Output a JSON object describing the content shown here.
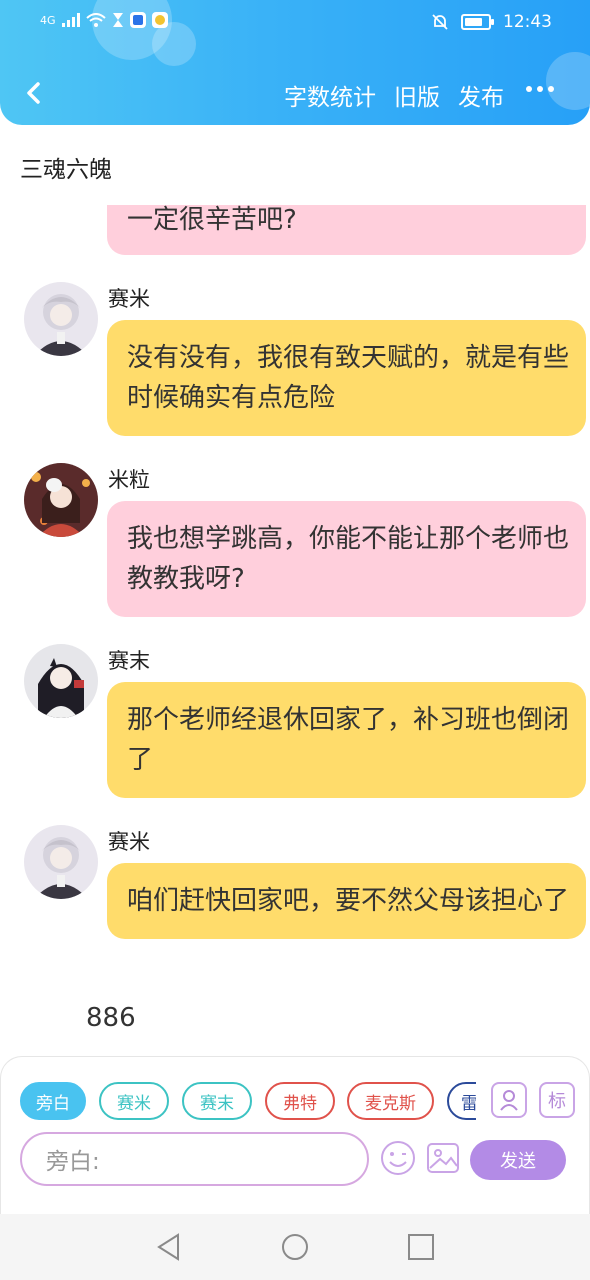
{
  "status_bar": {
    "network": "4G",
    "time": "12:43",
    "battery_level": 0.75
  },
  "header": {
    "actions": [
      "字数统计",
      "旧版",
      "发布"
    ]
  },
  "title": "三魂六魄",
  "messages": [
    {
      "speaker": "",
      "text": "一定很辛苦吧?",
      "color": "pink",
      "partial": true
    },
    {
      "speaker": "赛米",
      "text": "没有没有，我很有致天赋的，就是有些时候确实有点危险",
      "color": "yellow",
      "avatar": "silver-hair-boy-avatar"
    },
    {
      "speaker": "米粒",
      "text": "我也想学跳高，你能不能让那个老师也教教我呀?",
      "color": "pink",
      "avatar": "girl-with-mask-avatar"
    },
    {
      "speaker": "赛末",
      "text": "那个老师经退休回家了，补习班也倒闭了",
      "color": "yellow",
      "avatar": "dark-hair-girl-avatar"
    },
    {
      "speaker": "赛米",
      "text": "咱们赶快回家吧，要不然父母该担心了",
      "color": "yellow",
      "avatar": "silver-hair-boy-avatar"
    }
  ],
  "narration": "886",
  "composer": {
    "chips": [
      {
        "label": "旁白",
        "active": true,
        "color": "#49c3f0"
      },
      {
        "label": "赛米",
        "active": false,
        "color": "#3cc3c3"
      },
      {
        "label": "赛末",
        "active": false,
        "color": "#3cc3c3"
      },
      {
        "label": "弗特",
        "active": false,
        "color": "#e0524b"
      },
      {
        "label": "麦克斯",
        "active": false,
        "color": "#e0524b"
      },
      {
        "label": "雷",
        "active": false,
        "color": "#2b4a9a"
      }
    ],
    "mark_button": "标",
    "input_placeholder": "旁白:",
    "send_label": "发送"
  },
  "colors": {
    "header": "#3ab2f7",
    "pink_bubble": "#ffcfdc",
    "yellow_bubble": "#ffdc6b",
    "accent_purple": "#b38be6"
  }
}
